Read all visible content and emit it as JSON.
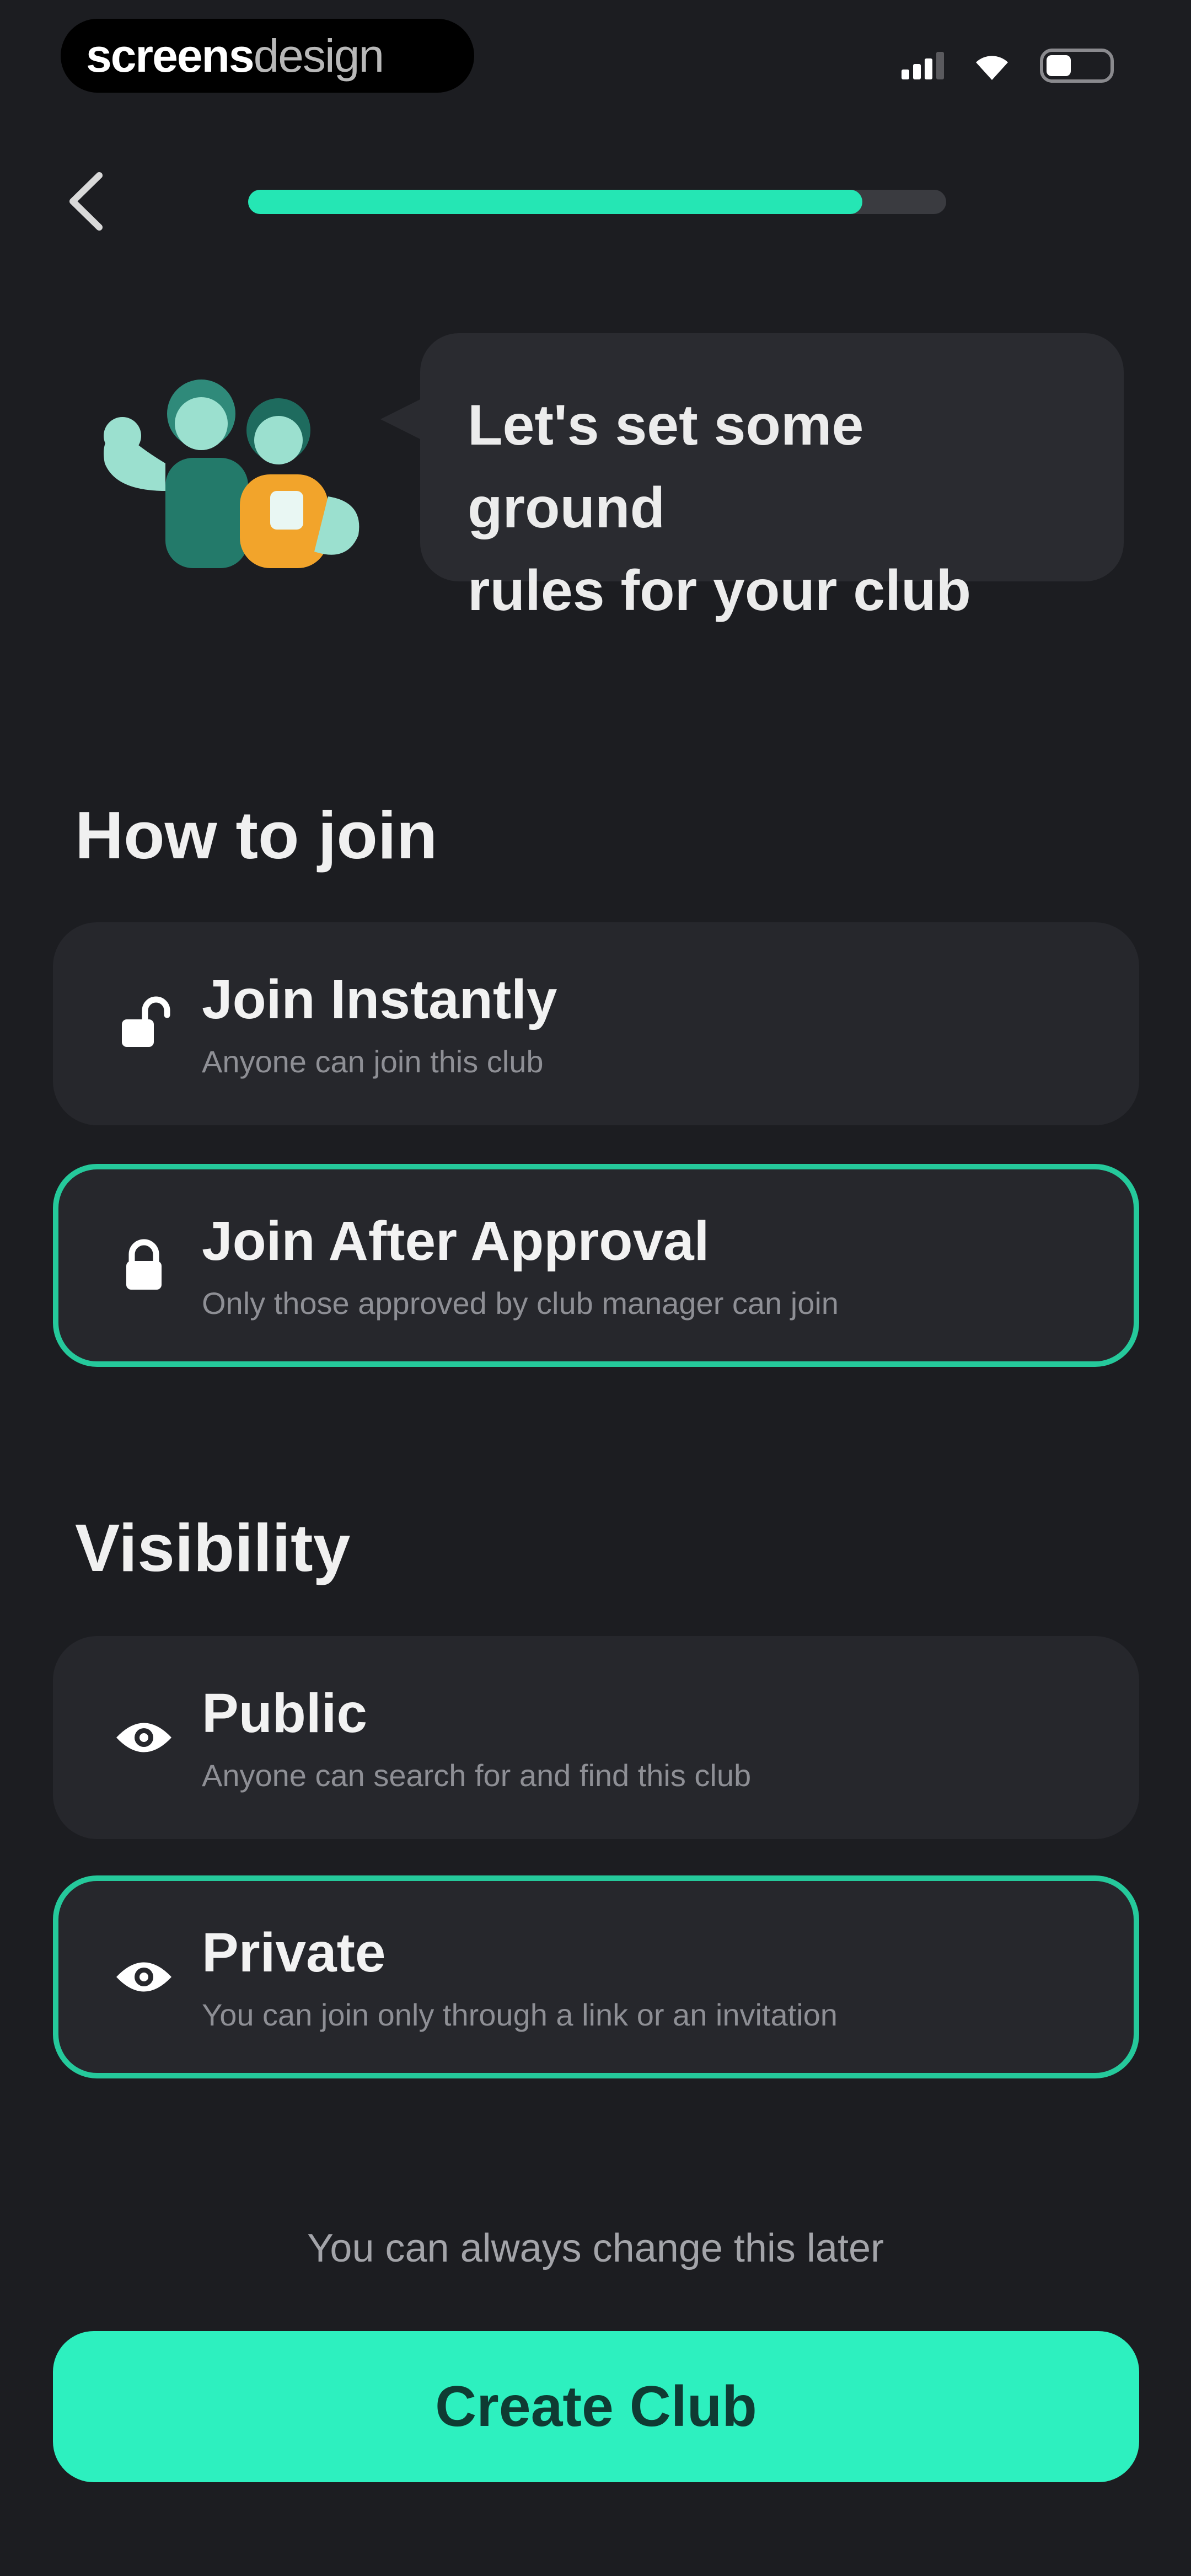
{
  "status_bar": {
    "brand_part1": "screens",
    "brand_part2": "design"
  },
  "progress": {
    "value": 0.88
  },
  "intro": {
    "message_line1": "Let's set some ground",
    "message_line2": "rules for your club"
  },
  "join_section": {
    "title": "How to join",
    "options": [
      {
        "title": "Join Instantly",
        "subtitle": "Anyone can join this club",
        "icon": "unlock-icon",
        "selected": false
      },
      {
        "title": "Join After Approval",
        "subtitle": "Only those approved by club manager can join",
        "icon": "lock-icon",
        "selected": true
      }
    ]
  },
  "visibility_section": {
    "title": "Visibility",
    "options": [
      {
        "title": "Public",
        "subtitle": "Anyone can search for and find this club",
        "icon": "eye-icon",
        "selected": false
      },
      {
        "title": "Private",
        "subtitle": "You can join only through a link or an invitation",
        "icon": "eye-icon",
        "selected": true
      }
    ]
  },
  "footer": {
    "note": "You can always change this later",
    "cta_label": "Create Club"
  },
  "colors": {
    "background": "#1c1d21",
    "accent": "#25e6b4",
    "card": "#26272c"
  }
}
